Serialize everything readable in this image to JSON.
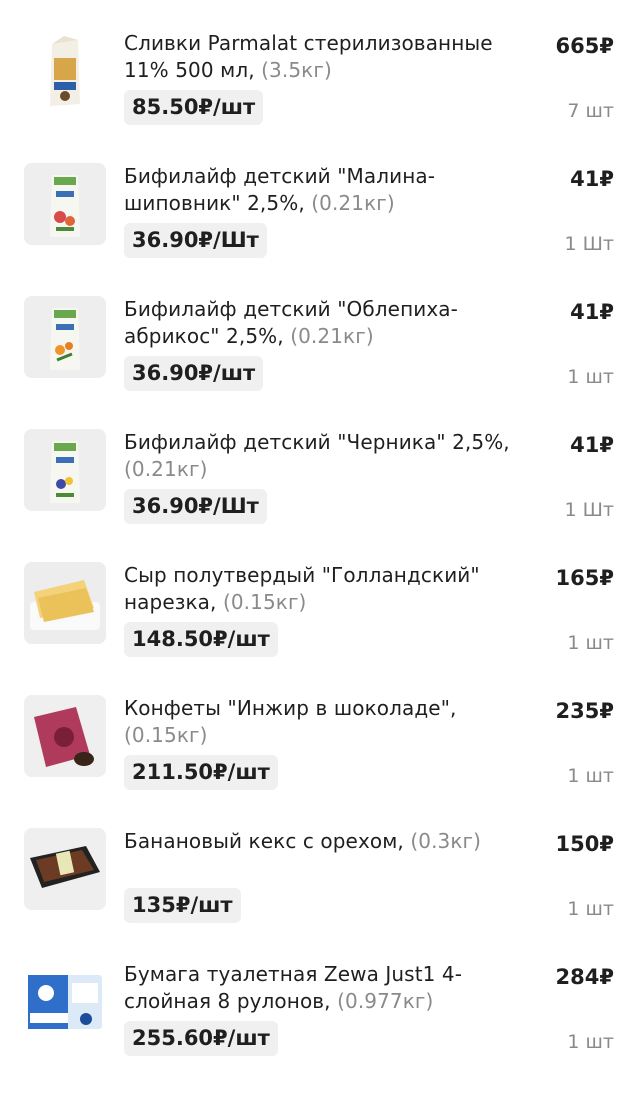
{
  "items": [
    {
      "name": "Сливки Parmalat стерилизованные 11% 500 мл,",
      "weight": "(3.5кг)",
      "unit_price": "85.50₽/шт",
      "total": "665₽",
      "qty": "7 шт",
      "image": "cream-carton-image"
    },
    {
      "name": "Бифилайф детский \"Малина-шиповник\" 2,5%,",
      "weight": "(0.21кг)",
      "unit_price": "36.90₽/Шт",
      "total": "41₽",
      "qty": "1 Шт",
      "image": "bifilife-raspberry-image"
    },
    {
      "name": "Бифилайф детский \"Облепиха-абрикос\" 2,5%,",
      "weight": "(0.21кг)",
      "unit_price": "36.90₽/шт",
      "total": "41₽",
      "qty": "1 шт",
      "image": "bifilife-seabuckthorn-image"
    },
    {
      "name": "Бифилайф детский \"Черника\" 2,5%,",
      "weight": "(0.21кг)",
      "unit_price": "36.90₽/Шт",
      "total": "41₽",
      "qty": "1 Шт",
      "image": "bifilife-blueberry-image"
    },
    {
      "name": "Сыр полутвердый \"Голландский\" нарезка,",
      "weight": "(0.15кг)",
      "unit_price": "148.50₽/шт",
      "total": "165₽",
      "qty": "1 шт",
      "image": "cheese-slices-image"
    },
    {
      "name": "Конфеты \"Инжир в шоколаде\",",
      "weight": "(0.15кг)",
      "unit_price": "211.50₽/шт",
      "total": "235₽",
      "qty": "1 шт",
      "image": "fig-candy-pack-image"
    },
    {
      "name": "Банановый кекс с орехом,",
      "weight": "(0.3кг)",
      "unit_price": "135₽/шт",
      "total": "150₽",
      "qty": "1 шт",
      "image": "banana-cake-tray-image"
    },
    {
      "name": "Бумага туалетная Zewa Just1 4-слойная 8 рулонов,",
      "weight": "(0.977кг)",
      "unit_price": "255.60₽/шт",
      "total": "284₽",
      "qty": "1 шт",
      "image": "zewa-toilet-paper-image"
    }
  ]
}
